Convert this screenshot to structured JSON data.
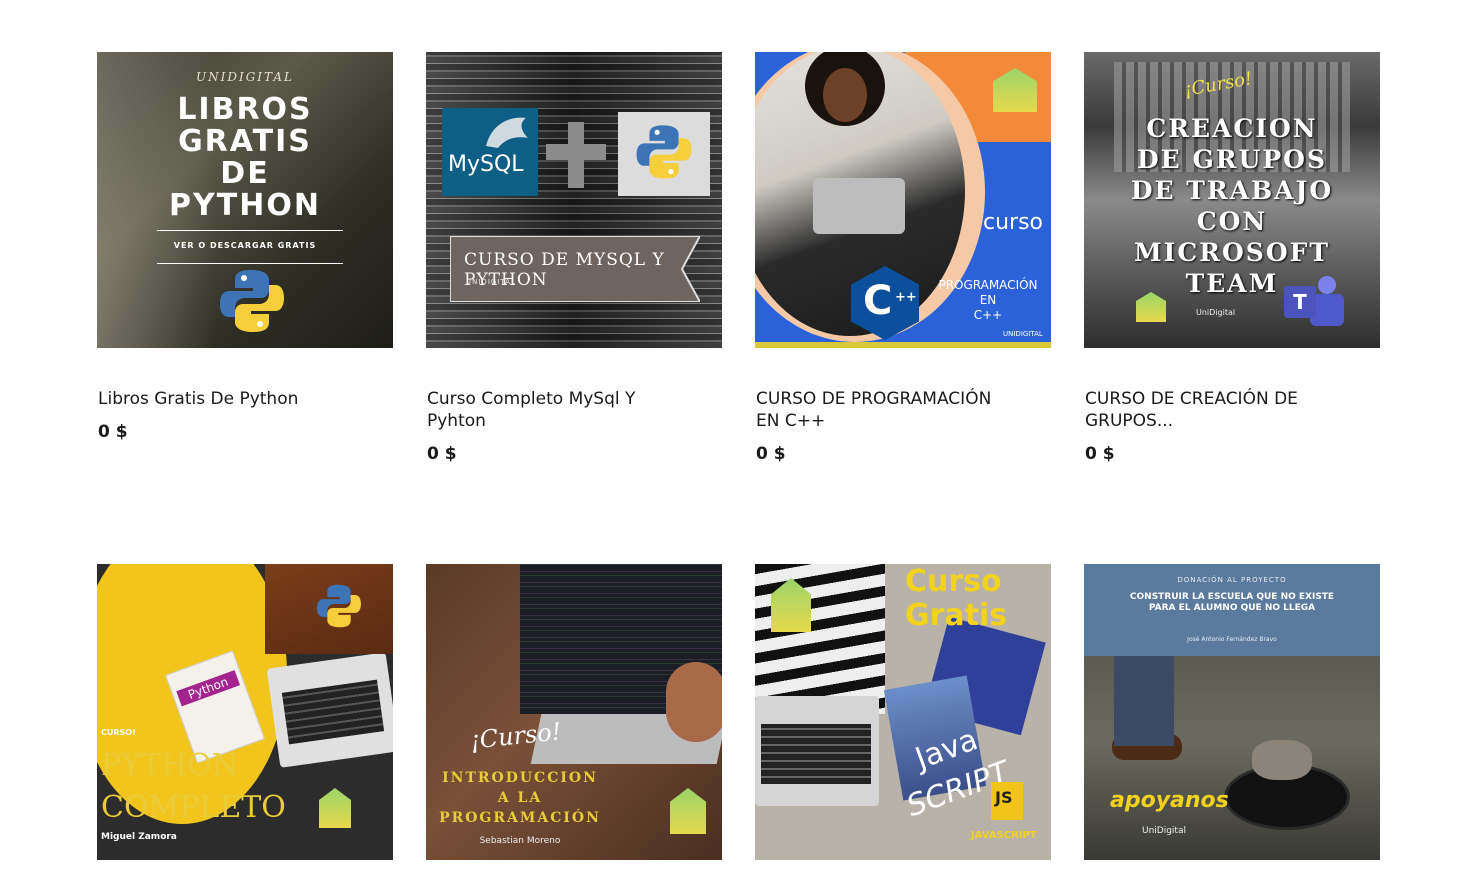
{
  "products": [
    {
      "title": "Libros Gratis De Python",
      "price": "0 $",
      "image": {
        "brand": "UNIDIGITAL",
        "headline": [
          "LIBROS",
          "GRATIS",
          "DE",
          "PYTHON"
        ],
        "subtitle": "VER O DESCARGAR GRATIS",
        "icon": "python-logo-icon"
      }
    },
    {
      "title": "Curso Completo MySql Y Pyhton",
      "price": "0 $",
      "image": {
        "mysql_label": "MySQL",
        "banner": "CURSO DE MYSQL Y PYTHON",
        "brand": "UNIDIGITAL",
        "icon": "python-logo-icon"
      }
    },
    {
      "title": "CURSO DE PROGRAMACIÓN EN C++",
      "price": "0 $",
      "image": {
        "curso": "curso",
        "lines": [
          "PROGRAMACIÓN",
          "EN",
          "C++"
        ],
        "brand": "UNIDIGITAL",
        "icon": "cpp-logo-icon"
      }
    },
    {
      "title": "CURSO DE CREACIÓN DE GRUPOS...",
      "price": "0 $",
      "image": {
        "tag": "¡Curso!",
        "headline": [
          "CREACION",
          "DE GRUPOS",
          "DE TRABAJO",
          "CON",
          "MICROSOFT",
          "TEAM"
        ],
        "brand": "UniDigital",
        "icon": "teams-logo-icon"
      }
    },
    {
      "image": {
        "tag": "CURSO!",
        "headline": [
          "PYTHON",
          "COMPLETO"
        ],
        "author": "Miguel Zamora",
        "book": "Python",
        "icon": "python-logo-icon"
      }
    },
    {
      "image": {
        "tag": "¡Curso!",
        "headline": [
          "INTRODUCCION",
          "A LA",
          "PROGRAMACIÓN"
        ],
        "author": "Sebastian Moreno"
      }
    },
    {
      "image": {
        "headline": [
          "Curso",
          "Gratis"
        ],
        "script": [
          "Java",
          "SCRIPT"
        ],
        "js": "JS",
        "footer": "JAVASCRIPT"
      }
    },
    {
      "image": {
        "top": "DONACIÓN AL PROYECTO",
        "headline": [
          "CONSTRUIR LA ESCUELA QUE NO EXISTE",
          "PARA EL ALUMNO QUE NO LLEGA"
        ],
        "author": "José Antonio Fernández Bravo",
        "cta": "apoyanos",
        "brand": "UniDigital"
      }
    }
  ]
}
